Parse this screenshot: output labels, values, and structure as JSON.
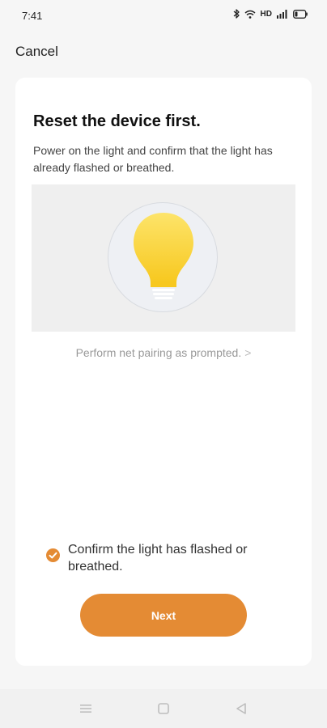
{
  "status_bar": {
    "time": "7:41",
    "hd": "HD",
    "icons": [
      "bluetooth-icon",
      "wifi-icon",
      "signal-icon",
      "battery-icon"
    ]
  },
  "nav": {
    "cancel_label": "Cancel"
  },
  "card": {
    "title": "Reset the device first.",
    "description": "Power on the light and confirm that the light has already flashed or breathed.",
    "illustration_icon": "light-bulb-icon",
    "pairing_link": "Perform net pairing as prompted.",
    "pairing_chevron": ">",
    "confirm_label": "Confirm the light has flashed or breathed.",
    "confirm_checked": true,
    "next_label": "Next"
  },
  "colors": {
    "accent": "#e48b34",
    "bulb": "#fbd43a",
    "background": "#f6f6f6",
    "card": "#ffffff"
  },
  "system_nav": [
    "menu-icon",
    "home-icon",
    "back-icon"
  ]
}
